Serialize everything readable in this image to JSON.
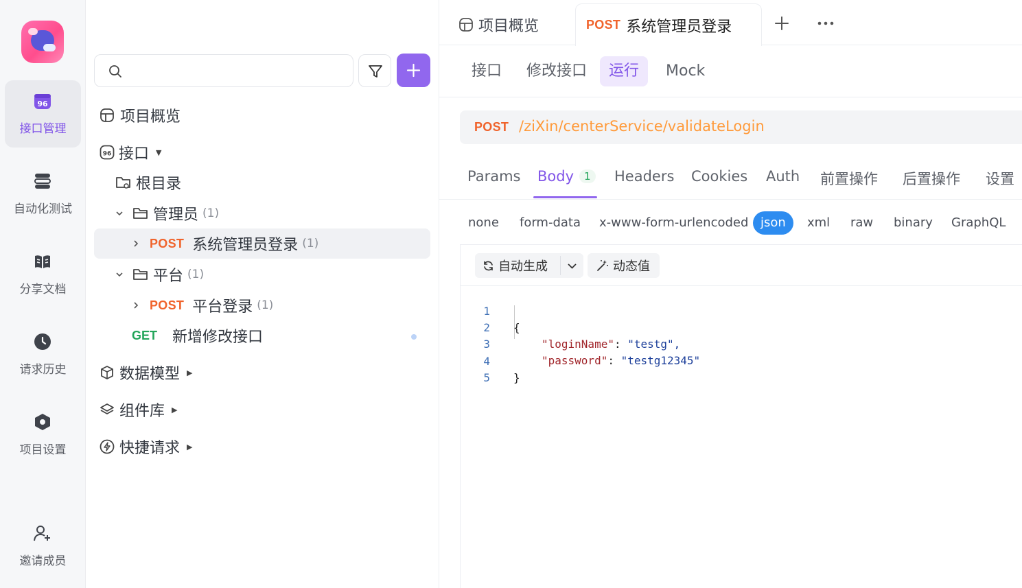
{
  "rail": {
    "items": [
      {
        "label": "接口管理",
        "icon": "api-management-icon"
      },
      {
        "label": "自动化测试",
        "icon": "automation-test-icon"
      },
      {
        "label": "分享文档",
        "icon": "share-doc-icon"
      },
      {
        "label": "请求历史",
        "icon": "clock-icon"
      },
      {
        "label": "项目设置",
        "icon": "settings-hexagon-icon"
      },
      {
        "label": "邀请成员",
        "icon": "add-user-icon"
      }
    ],
    "accent": "#8155e8"
  },
  "tree": {
    "search": {
      "placeholder": "",
      "value": ""
    },
    "nodes": {
      "overview": "项目概览",
      "apis": "接口",
      "root": "根目录",
      "folder_admin": {
        "label": "管理员",
        "count": "(1)"
      },
      "admin_login": {
        "method": "POST",
        "label": "系统管理员登录",
        "count": "(1)"
      },
      "folder_platform": {
        "label": "平台",
        "count": "(1)"
      },
      "platform_login": {
        "method": "POST",
        "label": "平台登录",
        "count": "(1)"
      },
      "new_api": {
        "method": "GET",
        "label": "新增修改接口"
      },
      "data_models": "数据模型",
      "components": "组件库",
      "quick_requests": "快捷请求"
    }
  },
  "doc_tabs": {
    "overview": "项目概览",
    "active": {
      "method": "POST",
      "label": "系统管理员登录"
    },
    "add": "+",
    "more": "···"
  },
  "sub_tabs": [
    "接口",
    "修改接口",
    "运行",
    "Mock"
  ],
  "sub_tabs_active": "运行",
  "request": {
    "method": "POST",
    "url": "/ziXin/centerService/validateLogin"
  },
  "request_tabs": [
    "Params",
    "Body",
    "Headers",
    "Cookies",
    "Auth",
    "前置操作",
    "后置操作",
    "设置"
  ],
  "body_badge": "1",
  "body_types": [
    "none",
    "form-data",
    "x-www-form-urlencoded",
    "json",
    "xml",
    "raw",
    "binary",
    "GraphQL"
  ],
  "body_type_active": "json",
  "editor": {
    "auto_generate": "自动生成",
    "dynamic_value": "动态值",
    "lines": [
      {
        "n": "1",
        "text": "{"
      },
      {
        "n": "2",
        "key": "\"loginName\"",
        "value": "\"testg\","
      },
      {
        "n": "3",
        "key": "\"password\"",
        "value": "\"testg12345\""
      },
      {
        "n": "4",
        "text": "}"
      },
      {
        "n": "5",
        "text": ""
      }
    ]
  },
  "colors": {
    "post": "#f0632b",
    "get": "#23a55a",
    "url": "#ff9a3a",
    "json_active": "#2d8cf0"
  }
}
